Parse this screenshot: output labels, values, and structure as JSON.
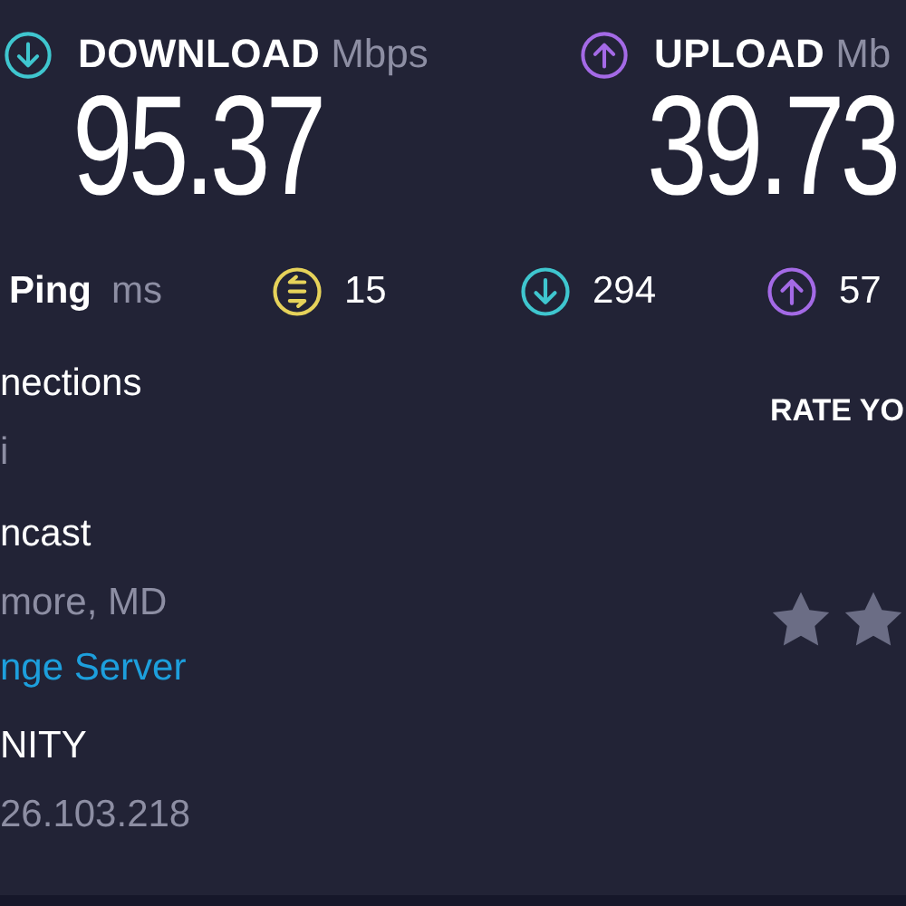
{
  "download": {
    "label": "DOWNLOAD",
    "unit": "Mbps",
    "value": "95.37"
  },
  "upload": {
    "label": "UPLOAD",
    "unit": "Mb",
    "value": "39.73"
  },
  "ping": {
    "label": "Ping",
    "unit": "ms",
    "items": [
      {
        "kind": "jitter",
        "value": "15"
      },
      {
        "kind": "download",
        "value": "294"
      },
      {
        "kind": "upload",
        "value": "57"
      }
    ]
  },
  "details": [
    {
      "kind": "heading",
      "text": "nections"
    },
    {
      "kind": "value",
      "text": "i"
    },
    {
      "kind": "heading",
      "text": "ncast"
    },
    {
      "kind": "value",
      "text": "more, MD"
    },
    {
      "kind": "link",
      "text": "nge Server"
    },
    {
      "kind": "heading",
      "text": "NITY"
    },
    {
      "kind": "value",
      "text": "26.103.218"
    }
  ],
  "rating": {
    "title": "RATE YO"
  }
}
